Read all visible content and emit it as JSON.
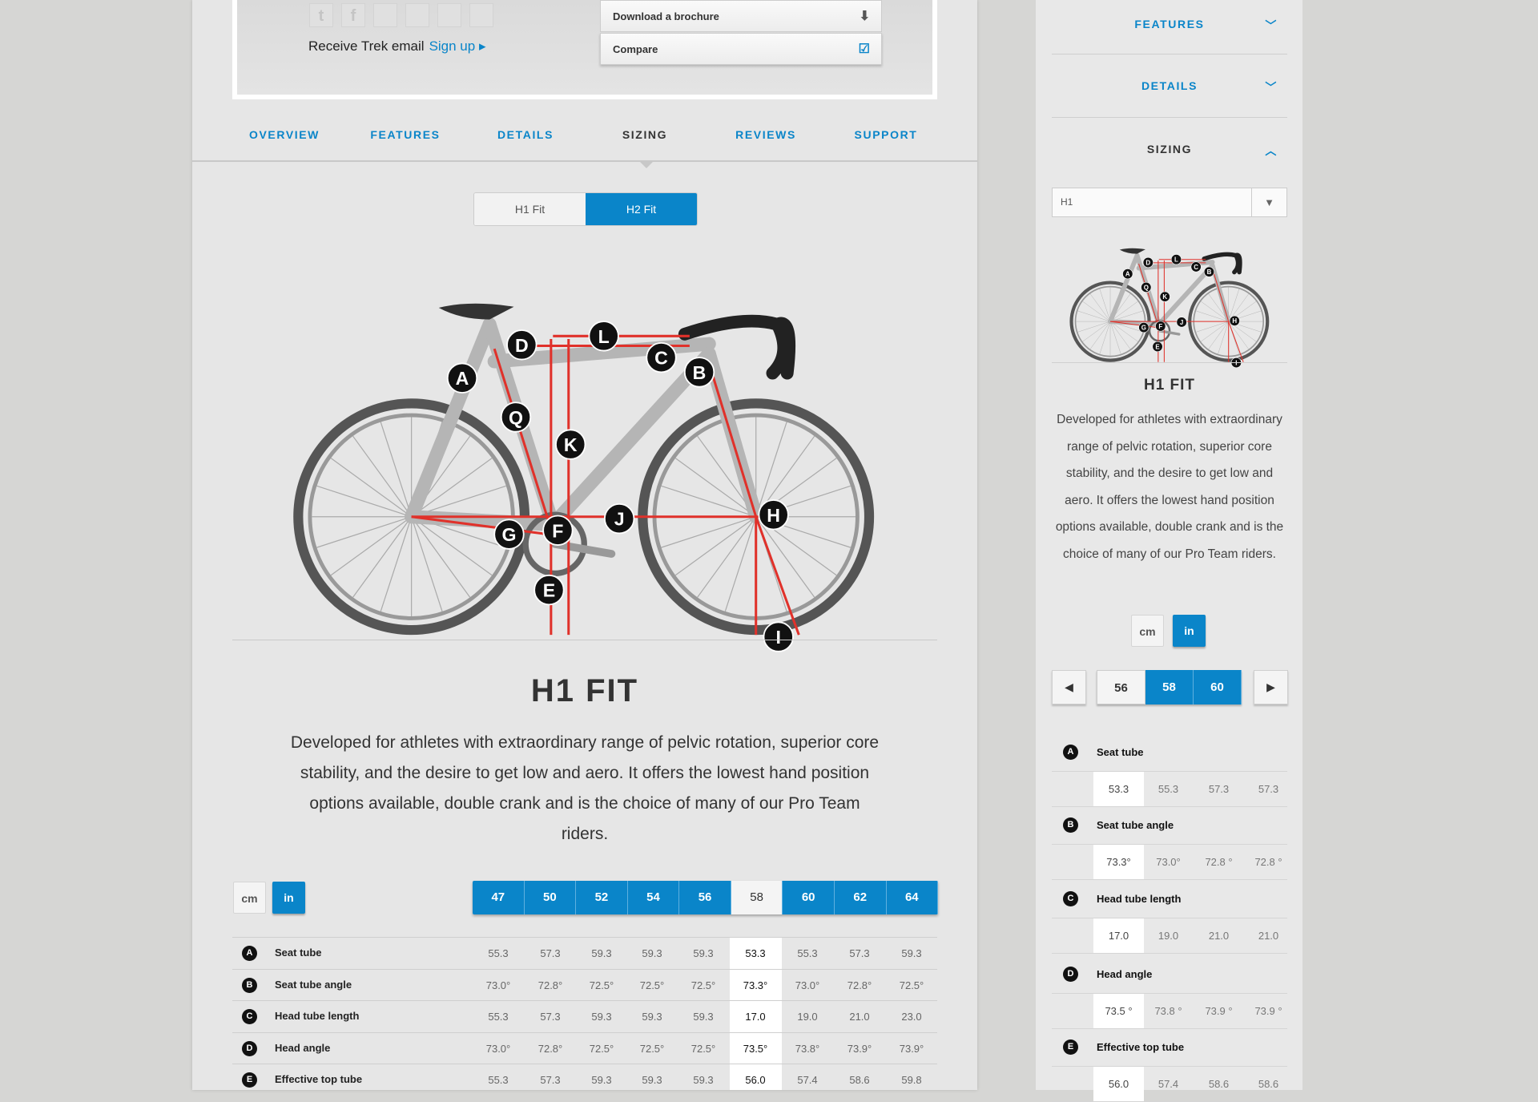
{
  "top": {
    "social_icons": [
      "twitter-icon",
      "facebook-icon",
      "share-icon",
      "share-icon",
      "share-icon",
      "share-icon"
    ],
    "email_text": "Receive Trek email",
    "signup": "Sign up ▸",
    "brochure": "Download a brochure",
    "compare": "Compare",
    "compare_checked": true
  },
  "nav": {
    "tabs": [
      "OVERVIEW",
      "FEATURES",
      "DETAILS",
      "SIZING",
      "REVIEWS",
      "SUPPORT"
    ],
    "active": "SIZING"
  },
  "fit_toggle": {
    "options": [
      "H1 Fit",
      "H2 Fit"
    ],
    "selected": "H2 Fit"
  },
  "markers": [
    "A",
    "B",
    "C",
    "D",
    "E",
    "F",
    "G",
    "H",
    "I",
    "J",
    "K",
    "L",
    "Q"
  ],
  "fit": {
    "title": "H1 FIT",
    "description": "Developed for athletes with extraordinary range of pelvic rotation, superior core stability, and the desire to get low and aero. It offers the lowest hand position options available, double crank and is the choice of many of our Pro Team riders."
  },
  "units": {
    "options": [
      "cm",
      "in"
    ],
    "selected": "in"
  },
  "sizes": {
    "options": [
      "47",
      "50",
      "52",
      "54",
      "56",
      "58",
      "60",
      "62",
      "64"
    ],
    "selected": "58"
  },
  "geometry": [
    {
      "letter": "A",
      "label": "Seat tube",
      "values": [
        "55.3",
        "57.3",
        "59.3",
        "59.3",
        "59.3",
        "53.3",
        "55.3",
        "57.3",
        "59.3"
      ]
    },
    {
      "letter": "B",
      "label": "Seat tube angle",
      "values": [
        "73.0°",
        "72.8°",
        "72.5°",
        "72.5°",
        "72.5°",
        "73.3°",
        "73.0°",
        "72.8°",
        "72.5°"
      ]
    },
    {
      "letter": "C",
      "label": "Head tube length",
      "values": [
        "55.3",
        "57.3",
        "59.3",
        "59.3",
        "59.3",
        "17.0",
        "19.0",
        "21.0",
        "23.0"
      ]
    },
    {
      "letter": "D",
      "label": "Head angle",
      "values": [
        "73.0°",
        "72.8°",
        "72.5°",
        "72.5°",
        "72.5°",
        "73.5°",
        "73.8°",
        "73.9°",
        "73.9°"
      ]
    },
    {
      "letter": "E",
      "label": "Effective top tube",
      "values": [
        "55.3",
        "57.3",
        "59.3",
        "59.3",
        "59.3",
        "56.0",
        "57.4",
        "58.6",
        "59.8"
      ]
    }
  ],
  "sidebar": {
    "accordion": [
      {
        "label": "FEATURES",
        "open": false
      },
      {
        "label": "DETAILS",
        "open": false
      },
      {
        "label": "SIZING",
        "open": true
      }
    ],
    "fit_select": "H1",
    "title": "H1 FIT",
    "description": "Developed for athletes with extraordinary range of pelvic rotation, superior core stability, and the desire to get low and aero. It offers the lowest hand position options available, double crank and is the choice of many of our Pro Team riders.",
    "units": {
      "options": [
        "cm",
        "in"
      ],
      "selected": "in"
    },
    "pager": {
      "sizes": [
        "56",
        "58",
        "60"
      ],
      "selected": "58"
    },
    "geometry": [
      {
        "letter": "A",
        "label": "Seat tube",
        "values": [
          "53.3",
          "55.3",
          "57.3",
          "57.3"
        ]
      },
      {
        "letter": "B",
        "label": "Seat tube angle",
        "values": [
          "73.3°",
          "73.0°",
          "72.8 °",
          "72.8 °"
        ]
      },
      {
        "letter": "C",
        "label": "Head tube length",
        "values": [
          "17.0",
          "19.0",
          "21.0",
          "21.0"
        ]
      },
      {
        "letter": "D",
        "label": "Head angle",
        "values": [
          "73.5 °",
          "73.8 °",
          "73.9 °",
          "73.9 °"
        ]
      },
      {
        "letter": "E",
        "label": "Effective top tube",
        "values": [
          "56.0",
          "57.4",
          "58.6",
          "58.6"
        ]
      }
    ]
  },
  "colors": {
    "accent": "#0a85c9",
    "marker": "#111111",
    "geometry_line": "#e0312a"
  }
}
